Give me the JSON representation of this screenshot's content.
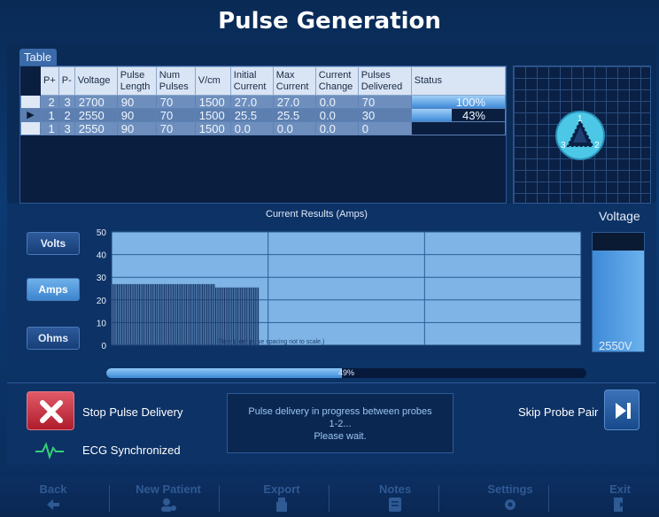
{
  "window": {
    "title": "Pulse Generation"
  },
  "table": {
    "tab_label": "Table",
    "headers": [
      "",
      "P+",
      "P-",
      "Voltage",
      "Pulse Length",
      "Num Pulses",
      "V/cm",
      "Initial Current",
      "Max Current",
      "Current Change",
      "Pulses Delivered",
      "Status"
    ],
    "rows": [
      {
        "pointer": "",
        "p_plus": "2",
        "p_minus": "3",
        "voltage": "2700",
        "pulse_length": "90",
        "num_pulses": "70",
        "v_cm": "1500",
        "initial_current": "27.0",
        "max_current": "27.0",
        "current_change": "0.0",
        "pulses_delivered": "70",
        "status": "100%",
        "status_fraction": 1.0
      },
      {
        "pointer": "▶",
        "p_plus": "1",
        "p_minus": "2",
        "voltage": "2550",
        "pulse_length": "90",
        "num_pulses": "70",
        "v_cm": "1500",
        "initial_current": "25.5",
        "max_current": "25.5",
        "current_change": "0.0",
        "pulses_delivered": "30",
        "status": "43%",
        "status_fraction": 0.43
      },
      {
        "pointer": "",
        "p_plus": "1",
        "p_minus": "3",
        "voltage": "2550",
        "pulse_length": "90",
        "num_pulses": "70",
        "v_cm": "1500",
        "initial_current": "0.0",
        "max_current": "0.0",
        "current_change": "0.0",
        "pulses_delivered": "0",
        "status": "",
        "status_fraction": 0.0
      }
    ]
  },
  "probe_map": {
    "labels": [
      "1",
      "2",
      "3"
    ]
  },
  "side_buttons": {
    "volts": "Volts",
    "amps": "Amps",
    "ohms": "Ohms",
    "active": "amps"
  },
  "chart_data": {
    "type": "bar",
    "title": "Current Results (Amps)",
    "xlabel": "Time (Inter pulse spacing not to scale.)",
    "ylabel": "",
    "ylim": [
      0,
      50
    ],
    "yticks": [
      0,
      10,
      20,
      30,
      40,
      50
    ],
    "grid": true,
    "series": [
      {
        "values": [
          27.0,
          27.0,
          27.0,
          27.0,
          27.0,
          27.0,
          27.0,
          27.0,
          27.0,
          27.0,
          27.0,
          27.0,
          27.0,
          27.0,
          27.0,
          27.0,
          27.0,
          27.0,
          27.0,
          27.0,
          27.0,
          27.0,
          27.0,
          27.0,
          27.0,
          27.0,
          27.0,
          27.0,
          27.0,
          27.0,
          27.0,
          27.0,
          27.0,
          27.0,
          27.0,
          27.0,
          27.0,
          27.0,
          27.0,
          27.0,
          27.0,
          27.0,
          27.0,
          27.0,
          27.0,
          27.0,
          27.0,
          27.0,
          27.0,
          27.0,
          27.0,
          27.0,
          27.0,
          27.0,
          27.0,
          27.0,
          27.0,
          27.0,
          27.0,
          27.0,
          27.0,
          27.0,
          27.0,
          27.0,
          27.0,
          27.0,
          27.0,
          27.0,
          27.0,
          27.0
        ]
      },
      {
        "values": [
          25.5,
          25.5,
          25.5,
          25.5,
          25.5,
          25.5,
          25.5,
          25.5,
          25.5,
          25.5,
          25.5,
          25.5,
          25.5,
          25.5,
          25.5,
          25.5,
          25.5,
          25.5,
          25.5,
          25.5,
          25.5,
          25.5,
          25.5,
          25.5,
          25.5,
          25.5,
          25.5,
          25.5,
          25.5,
          25.5
        ]
      }
    ]
  },
  "voltage_meter": {
    "title": "Voltage",
    "value": "2550V",
    "fraction": 0.85
  },
  "progress": {
    "text": "49%",
    "fraction": 0.49
  },
  "actions": {
    "stop_label": "Stop Pulse Delivery",
    "ecg_label": "ECG Synchronized",
    "message_line1": "Pulse delivery in progress between probes",
    "message_line2": "1-2...",
    "message_line3": "Please wait.",
    "skip_label": "Skip Probe Pair"
  },
  "footer": {
    "items": [
      {
        "label": "Back",
        "icon": "arrow-left-icon"
      },
      {
        "label": "New Patient",
        "icon": "add-user-icon"
      },
      {
        "label": "Export",
        "icon": "usb-icon"
      },
      {
        "label": "Notes",
        "icon": "notes-icon"
      },
      {
        "label": "Settings",
        "icon": "gear-icon"
      },
      {
        "label": "Exit",
        "icon": "exit-icon"
      }
    ]
  },
  "colors": {
    "accent": "#4a9ae6",
    "stop": "#c8283a",
    "ecg": "#35d07a"
  }
}
